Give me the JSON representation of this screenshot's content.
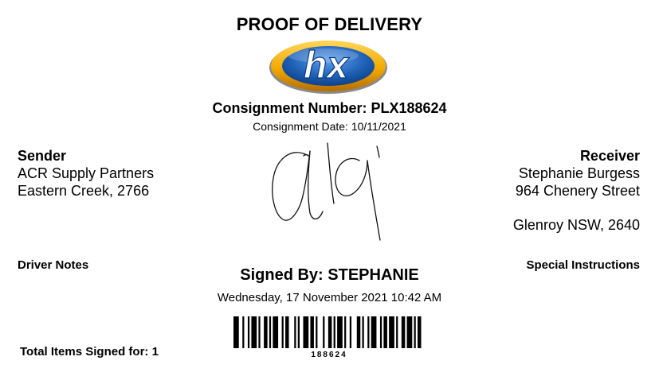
{
  "title": "PROOF OF DELIVERY",
  "logo": {
    "text": "hx",
    "colors": {
      "ring": "#f2a900",
      "disc": "#1d5fb4",
      "outline": "#6b6b6b"
    }
  },
  "consignment": {
    "number_label": "Consignment Number: PLX188624",
    "date_label": "Consignment Date: 10/11/2021"
  },
  "sender": {
    "heading": "Sender",
    "name": "ACR Supply Partners",
    "location": "Eastern Creek, 2766"
  },
  "receiver": {
    "heading": "Receiver",
    "name": "Stephanie Burgess",
    "street": "964 Chenery Street",
    "city": "Glenroy NSW, 2640"
  },
  "driver_notes_label": "Driver Notes",
  "special_instructions_label": "Special Instructions",
  "signed_by": "Signed By: STEPHANIE",
  "signed_datetime": "Wednesday, 17 November 2021 10:42 AM",
  "total_items": "Total Items Signed for: 1",
  "barcode": {
    "value": "188624"
  }
}
